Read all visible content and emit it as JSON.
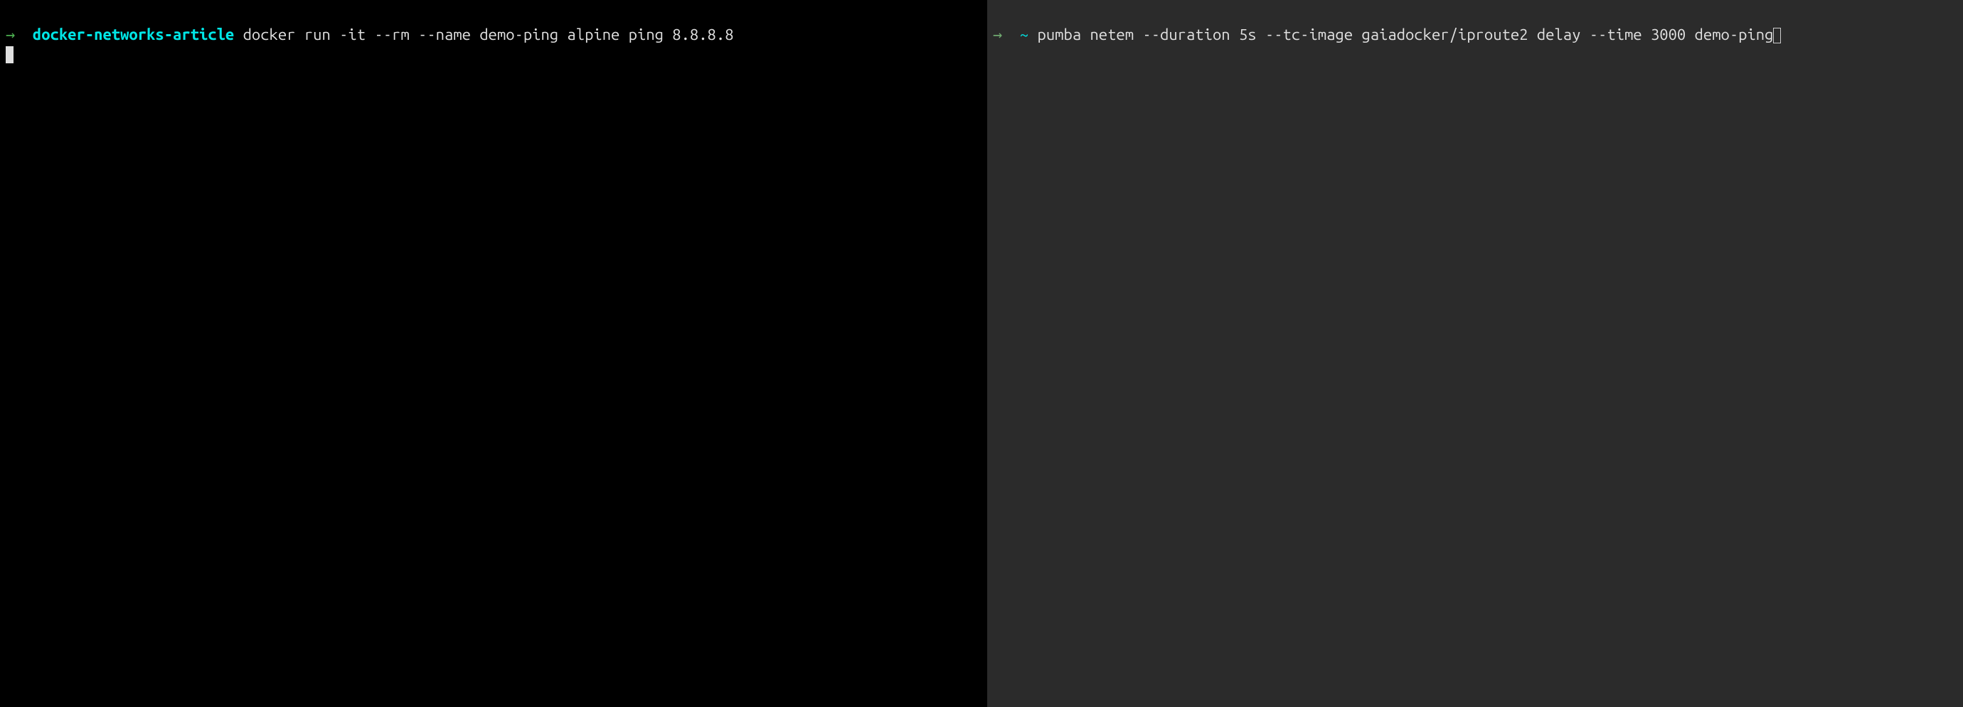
{
  "left_pane": {
    "prompt_arrow": "→",
    "prompt_dir": "docker-networks-article",
    "command": "docker run -it --rm --name demo-ping alpine ping 8.8.8.8"
  },
  "right_pane": {
    "prompt_arrow": "→",
    "prompt_tilde": "~",
    "command": "pumba netem --duration 5s --tc-image gaiadocker/iproute2 delay --time 3000 demo-ping"
  }
}
